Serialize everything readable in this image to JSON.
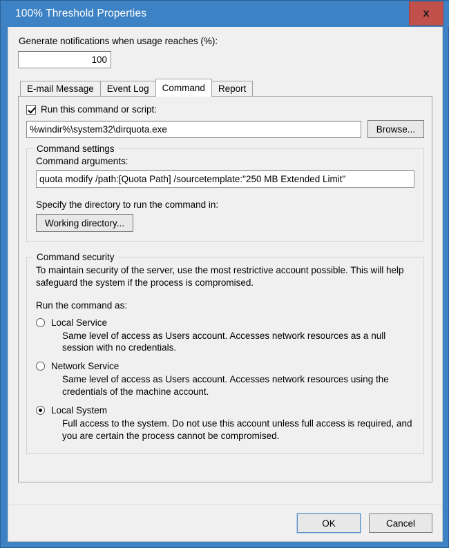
{
  "window": {
    "title": "100% Threshold Properties",
    "close_label": "x",
    "close_icon": "close-icon",
    "accent_color": "#3c82c4",
    "close_color": "#c1504b",
    "dialog_bg": "#f0f0f0"
  },
  "threshold": {
    "label": "Generate notifications when usage reaches (%):",
    "value": "100"
  },
  "tabs": [
    {
      "label": "E-mail Message",
      "active": false
    },
    {
      "label": "Event Log",
      "active": false
    },
    {
      "label": "Command",
      "active": true
    },
    {
      "label": "Report",
      "active": false
    }
  ],
  "command": {
    "run_checkbox_label": "Run this command or script:",
    "run_checkbox_checked": true,
    "command_path": "%windir%\\system32\\dirquota.exe",
    "browse_label": "Browse...",
    "settings_group_title": "Command settings",
    "arguments_label": "Command arguments:",
    "arguments_value": "quota modify /path:[Quota Path] /sourcetemplate:\"250 MB Extended Limit\"",
    "directory_label": "Specify the directory to run the command in:",
    "working_directory_label": "Working directory..."
  },
  "security": {
    "group_title": "Command security",
    "description": "To maintain security of the server, use the most restrictive account possible. This will help safeguard the system if the process is compromised.",
    "run_as_label": "Run the command as:",
    "options": [
      {
        "label": "Local Service",
        "selected": false,
        "description": "Same level of access as Users account. Accesses network resources as a null session with no credentials."
      },
      {
        "label": "Network Service",
        "selected": false,
        "description": "Same level of access as Users account. Accesses network resources using the credentials of the machine account."
      },
      {
        "label": "Local System",
        "selected": true,
        "description": "Full access to the system. Do not use this account unless full access is required, and you are certain the process cannot be compromised."
      }
    ]
  },
  "footer": {
    "ok_label": "OK",
    "cancel_label": "Cancel"
  }
}
